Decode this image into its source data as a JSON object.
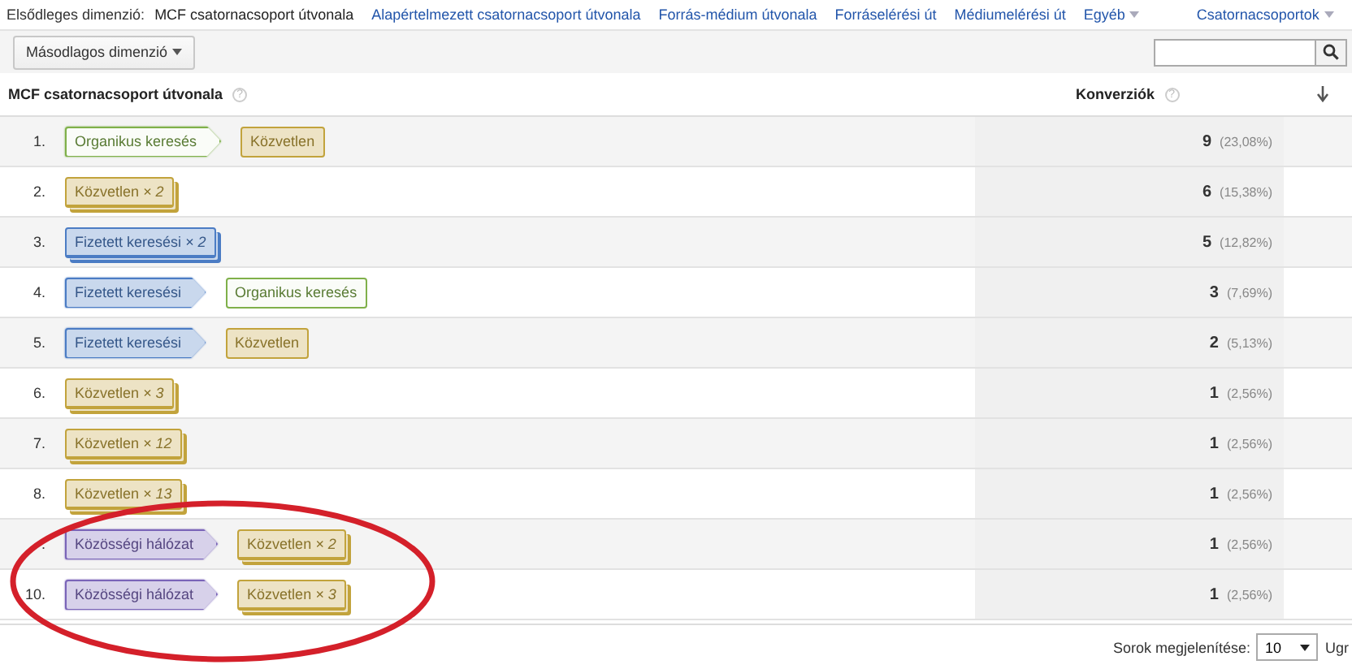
{
  "primary_dimension": {
    "label": "Elsődleges dimenzió:",
    "options": [
      {
        "label": "MCF csatornacsoport útvonala",
        "selected": true,
        "dropdown": false
      },
      {
        "label": "Alapértelmezett csatornacsoport útvonala",
        "selected": false,
        "dropdown": false
      },
      {
        "label": "Forrás-médium útvonala",
        "selected": false,
        "dropdown": false
      },
      {
        "label": "Forráselérési út",
        "selected": false,
        "dropdown": false
      },
      {
        "label": "Médiumelérési út",
        "selected": false,
        "dropdown": false
      },
      {
        "label": "Egyéb",
        "selected": false,
        "dropdown": true
      },
      {
        "label": "Csatornacsoportok",
        "selected": false,
        "dropdown": true
      }
    ]
  },
  "secondary_dimension": {
    "label": "Másodlagos dimenzió"
  },
  "table": {
    "columns": [
      {
        "label": "MCF csatornacsoport útvonala",
        "help": "?"
      },
      {
        "label": "Konverziók",
        "help": "?",
        "sorted": true
      }
    ],
    "rows": [
      {
        "index": "1.",
        "path": [
          {
            "label": "Organikus keresés",
            "color": "#7fb04a",
            "stacked": false
          },
          {
            "label": "Közvetlen",
            "color": "#c2a33c",
            "stacked": false
          }
        ],
        "value": "9",
        "share": "(23,08%)"
      },
      {
        "index": "2.",
        "path": [
          {
            "label": "Közvetlen *× 2*",
            "color": "#c2a33c",
            "stacked": true
          }
        ],
        "value": "6",
        "share": "(15,38%)"
      },
      {
        "index": "3.",
        "path": [
          {
            "label": "Fizetett keresési *× 2*",
            "color": "#4b7cc4",
            "stacked": true
          }
        ],
        "value": "5",
        "share": "(12,82%)"
      },
      {
        "index": "4.",
        "path": [
          {
            "label": "Fizetett keresési",
            "color": "#4b7cc4",
            "stacked": false
          },
          {
            "label": "Organikus keresés",
            "color": "#7fb04a",
            "stacked": false
          }
        ],
        "value": "3",
        "share": "(7,69%)"
      },
      {
        "index": "5.",
        "path": [
          {
            "label": "Fizetett keresési",
            "color": "#4b7cc4",
            "stacked": false
          },
          {
            "label": "Közvetlen",
            "color": "#c2a33c",
            "stacked": false
          }
        ],
        "value": "2",
        "share": "(5,13%)"
      },
      {
        "index": "6.",
        "path": [
          {
            "label": "Közvetlen *× 3*",
            "color": "#c2a33c",
            "stacked": true
          }
        ],
        "value": "1",
        "share": "(2,56%)"
      },
      {
        "index": "7.",
        "path": [
          {
            "label": "Közvetlen *× 12*",
            "color": "#c2a33c",
            "stacked": true
          }
        ],
        "value": "1",
        "share": "(2,56%)"
      },
      {
        "index": "8.",
        "path": [
          {
            "label": "Közvetlen *× 13*",
            "color": "#c2a33c",
            "stacked": true
          }
        ],
        "value": "1",
        "share": "(2,56%)"
      },
      {
        "index": ".",
        "path": [
          {
            "label": "Közösségi hálózat",
            "color": "#7a64b8",
            "stacked": false
          },
          {
            "label": "Közvetlen *× 2*",
            "color": "#c2a33c",
            "stacked": true
          }
        ],
        "value": "1",
        "share": "(2,56%)"
      },
      {
        "index": "10.",
        "path": [
          {
            "label": "Közösségi hálózat",
            "color": "#7a64b8",
            "stacked": false
          },
          {
            "label": "Közvetlen *× 3*",
            "color": "#c2a33c",
            "stacked": true
          }
        ],
        "value": "1",
        "share": "(2,56%)"
      }
    ]
  },
  "footer": {
    "rows_label": "Sorok megjelenítése:",
    "rows_value": "10",
    "goto_label": "Ugr"
  }
}
